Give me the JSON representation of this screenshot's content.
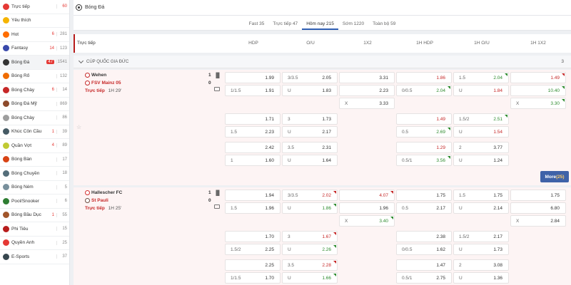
{
  "sidebar": {
    "items": [
      {
        "label": "Trực tiếp",
        "badge": "",
        "count": "60",
        "icon": "live-icon",
        "color": "#e53935",
        "count_red": true
      },
      {
        "label": "Yêu thích",
        "badge": "",
        "count": "",
        "icon": "star-icon",
        "color": "#f5b400"
      },
      {
        "label": "Hot",
        "badge": "6",
        "count": "281",
        "icon": "fire-icon",
        "color": "#ff6d00"
      },
      {
        "label": "Fantasy",
        "badge": "14",
        "count": "123",
        "icon": "fantasy-icon",
        "color": "#3949ab"
      },
      {
        "label": "Bóng Đá",
        "badge": "47",
        "count": "1541",
        "icon": "soccer-ball-icon",
        "color": "#333333",
        "active": true,
        "pill": true
      },
      {
        "label": "Bóng Rổ",
        "badge": "",
        "count": "132",
        "icon": "basketball-icon",
        "color": "#ef6c00"
      },
      {
        "label": "Bóng Chày",
        "badge": "6",
        "count": "14",
        "icon": "baseball-icon",
        "color": "#c62828"
      },
      {
        "label": "Bóng Đá Mỹ",
        "badge": "",
        "count": "869",
        "icon": "american-football-icon",
        "color": "#8d4a2b"
      },
      {
        "label": "Bóng Chày",
        "badge": "",
        "count": "86",
        "icon": "baseball-icon",
        "color": "#9e9e9e"
      },
      {
        "label": "Khúc Côn Cầu",
        "badge": "1",
        "count": "39",
        "icon": "hockey-icon",
        "color": "#455a64"
      },
      {
        "label": "Quần Vợt",
        "badge": "4",
        "count": "89",
        "icon": "tennis-icon",
        "color": "#c0ca33"
      },
      {
        "label": "Bóng Bàn",
        "badge": "",
        "count": "17",
        "icon": "table-tennis-icon",
        "color": "#d84315"
      },
      {
        "label": "Bóng Chuyền",
        "badge": "",
        "count": "18",
        "icon": "volleyball-icon",
        "color": "#546e7a"
      },
      {
        "label": "Bóng Ném",
        "badge": "",
        "count": "5",
        "icon": "handball-icon",
        "color": "#78909c"
      },
      {
        "label": "Pool/Snooker",
        "badge": "",
        "count": "6",
        "icon": "snooker-icon",
        "color": "#2e7d32"
      },
      {
        "label": "Bóng Bầu Dục",
        "badge": "1",
        "count": "55",
        "icon": "rugby-icon",
        "color": "#a1552a"
      },
      {
        "label": "Phi Tiêu",
        "badge": "",
        "count": "15",
        "icon": "darts-icon",
        "color": "#b71c1c"
      },
      {
        "label": "Quyền Anh",
        "badge": "",
        "count": "25",
        "icon": "boxing-icon",
        "color": "#e53935"
      },
      {
        "label": "E-Sports",
        "badge": "",
        "count": "37",
        "icon": "esports-icon",
        "color": "#37474f"
      }
    ]
  },
  "topbar": {
    "title": "Bóng Đá"
  },
  "tabs": [
    {
      "label": "Fast 35"
    },
    {
      "label": "Trực tiếp 47"
    },
    {
      "label": "Hôm nay 215",
      "active": true
    },
    {
      "label": "Sớm 1220"
    },
    {
      "label": "Toàn bộ 59"
    }
  ],
  "columns": {
    "live": "Trực tiếp",
    "hdp": "HDP",
    "ou": "O/U",
    "x12": "1X2",
    "h1hdp": "1H HDP",
    "h1ou": "1H O/U",
    "h1x12": "1H 1X2"
  },
  "league": {
    "name": "CÚP QUỐC GIA ĐỨC",
    "count": "3"
  },
  "more": {
    "label": "More",
    "count": "(25)"
  },
  "matches": [
    {
      "home": "Wehen",
      "away": "FSV Mainz 05",
      "home_score": "1",
      "away_score": "0",
      "live": "Trực tiếp",
      "time": "1H 29'",
      "home_crest": "#c62828",
      "away_crest": "#c62828"
    },
    {
      "home": "Hallescher FC",
      "away": "St Pauli",
      "home_score": "1",
      "away_score": "0",
      "live": "Trực tiếp",
      "time": "1H 25'",
      "home_crest": "#d32f2f",
      "away_crest": "#6d4c41"
    }
  ],
  "odds": [
    {
      "row": 0,
      "col": 0,
      "lbl": "",
      "val": "1.99"
    },
    {
      "row": 0,
      "col": 1,
      "lbl": "3/3.5",
      "val": "2.05"
    },
    {
      "row": 0,
      "col": 2,
      "lbl": "",
      "val": "3.31"
    },
    {
      "row": 0,
      "col": 3,
      "lbl": "",
      "val": "1.86",
      "color": "red"
    },
    {
      "row": 0,
      "col": 4,
      "lbl": "1.5",
      "val": "2.04",
      "color": "green",
      "tri": "g"
    },
    {
      "row": 0,
      "col": 5,
      "lbl": "",
      "val": "1.49",
      "color": "red",
      "tri": "r"
    },
    {
      "row": 1,
      "col": 0,
      "lbl": "1/1.5",
      "val": "1.91"
    },
    {
      "row": 1,
      "col": 1,
      "lbl": "U",
      "val": "1.83"
    },
    {
      "row": 1,
      "col": 2,
      "lbl": "",
      "val": "2.23"
    },
    {
      "row": 1,
      "col": 3,
      "lbl": "0/0.5",
      "val": "2.04",
      "color": "green",
      "tri": "g"
    },
    {
      "row": 1,
      "col": 4,
      "lbl": "U",
      "val": "1.84",
      "color": "red"
    },
    {
      "row": 1,
      "col": 5,
      "lbl": "",
      "val": "10.40",
      "color": "green",
      "tri": "g"
    },
    {
      "row": 2,
      "col": 2,
      "lbl": "X",
      "val": "3.33"
    },
    {
      "row": 2,
      "col": 5,
      "lbl": "X",
      "val": "3.30",
      "color": "green",
      "tri": "g"
    },
    {
      "row": 3,
      "col": 0,
      "lbl": "",
      "val": "1.71"
    },
    {
      "row": 3,
      "col": 1,
      "lbl": "3",
      "val": "1.73"
    },
    {
      "row": 3,
      "col": 3,
      "lbl": "",
      "val": "1.49",
      "color": "red"
    },
    {
      "row": 3,
      "col": 4,
      "lbl": "1.5/2",
      "val": "2.51",
      "color": "green",
      "tri": "g"
    },
    {
      "row": 4,
      "col": 0,
      "lbl": "1.5",
      "val": "2.23"
    },
    {
      "row": 4,
      "col": 1,
      "lbl": "U",
      "val": "2.17"
    },
    {
      "row": 4,
      "col": 3,
      "lbl": "0.5",
      "val": "2.69",
      "color": "green",
      "tri": "g"
    },
    {
      "row": 4,
      "col": 4,
      "lbl": "U",
      "val": "1.54",
      "color": "red"
    },
    {
      "row": 5,
      "col": 0,
      "lbl": "",
      "val": "2.42"
    },
    {
      "row": 5,
      "col": 1,
      "lbl": "3.5",
      "val": "2.31"
    },
    {
      "row": 5,
      "col": 3,
      "lbl": "",
      "val": "1.29",
      "color": "red"
    },
    {
      "row": 5,
      "col": 4,
      "lbl": "2",
      "val": "3.77"
    },
    {
      "row": 6,
      "col": 0,
      "lbl": "1",
      "val": "1.60"
    },
    {
      "row": 6,
      "col": 1,
      "lbl": "U",
      "val": "1.64"
    },
    {
      "row": 6,
      "col": 3,
      "lbl": "0.5/1",
      "val": "3.56",
      "color": "green",
      "tri": "g"
    },
    {
      "row": 6,
      "col": 4,
      "lbl": "U",
      "val": "1.24"
    },
    {
      "row": 7,
      "col": 0,
      "lbl": "",
      "val": "1.94"
    },
    {
      "row": 7,
      "col": 1,
      "lbl": "3/3.5",
      "val": "2.02",
      "color": "red",
      "tri": "r"
    },
    {
      "row": 7,
      "col": 2,
      "lbl": "",
      "val": "4.07",
      "color": "red",
      "tri": "r"
    },
    {
      "row": 7,
      "col": 3,
      "lbl": "",
      "val": "1.75"
    },
    {
      "row": 7,
      "col": 4,
      "lbl": "1.5",
      "val": "1.75"
    },
    {
      "row": 7,
      "col": 5,
      "lbl": "",
      "val": "1.75"
    },
    {
      "row": 8,
      "col": 0,
      "lbl": "1.5",
      "val": "1.96"
    },
    {
      "row": 8,
      "col": 1,
      "lbl": "U",
      "val": "1.86",
      "color": "green",
      "tri": "g"
    },
    {
      "row": 8,
      "col": 2,
      "lbl": "",
      "val": "1.96"
    },
    {
      "row": 8,
      "col": 3,
      "lbl": "0.5",
      "val": "2.17"
    },
    {
      "row": 8,
      "col": 4,
      "lbl": "U",
      "val": "2.14"
    },
    {
      "row": 8,
      "col": 5,
      "lbl": "",
      "val": "6.80"
    },
    {
      "row": 9,
      "col": 2,
      "lbl": "X",
      "val": "3.40",
      "color": "green",
      "tri": "g"
    },
    {
      "row": 9,
      "col": 5,
      "lbl": "X",
      "val": "2.84"
    },
    {
      "row": 10,
      "col": 0,
      "lbl": "",
      "val": "1.70"
    },
    {
      "row": 10,
      "col": 1,
      "lbl": "3",
      "val": "1.67",
      "color": "red",
      "tri": "r"
    },
    {
      "row": 10,
      "col": 3,
      "lbl": "",
      "val": "2.38"
    },
    {
      "row": 10,
      "col": 4,
      "lbl": "1.5/2",
      "val": "2.17"
    },
    {
      "row": 11,
      "col": 0,
      "lbl": "1.5/2",
      "val": "2.25"
    },
    {
      "row": 11,
      "col": 1,
      "lbl": "U",
      "val": "2.26",
      "color": "green",
      "tri": "g"
    },
    {
      "row": 11,
      "col": 3,
      "lbl": "0/0.5",
      "val": "1.62"
    },
    {
      "row": 11,
      "col": 4,
      "lbl": "U",
      "val": "1.73"
    },
    {
      "row": 12,
      "col": 0,
      "lbl": "",
      "val": "2.25"
    },
    {
      "row": 12,
      "col": 1,
      "lbl": "3.5",
      "val": "2.28",
      "color": "red",
      "tri": "r"
    },
    {
      "row": 12,
      "col": 3,
      "lbl": "",
      "val": "1.47"
    },
    {
      "row": 12,
      "col": 4,
      "lbl": "2",
      "val": "3.08"
    },
    {
      "row": 13,
      "col": 0,
      "lbl": "1/1.5",
      "val": "1.70"
    },
    {
      "row": 13,
      "col": 1,
      "lbl": "U",
      "val": "1.66",
      "color": "green",
      "tri": "g"
    },
    {
      "row": 13,
      "col": 3,
      "lbl": "0.5/1",
      "val": "2.75"
    },
    {
      "row": 13,
      "col": 4,
      "lbl": "U",
      "val": "1.36"
    }
  ]
}
